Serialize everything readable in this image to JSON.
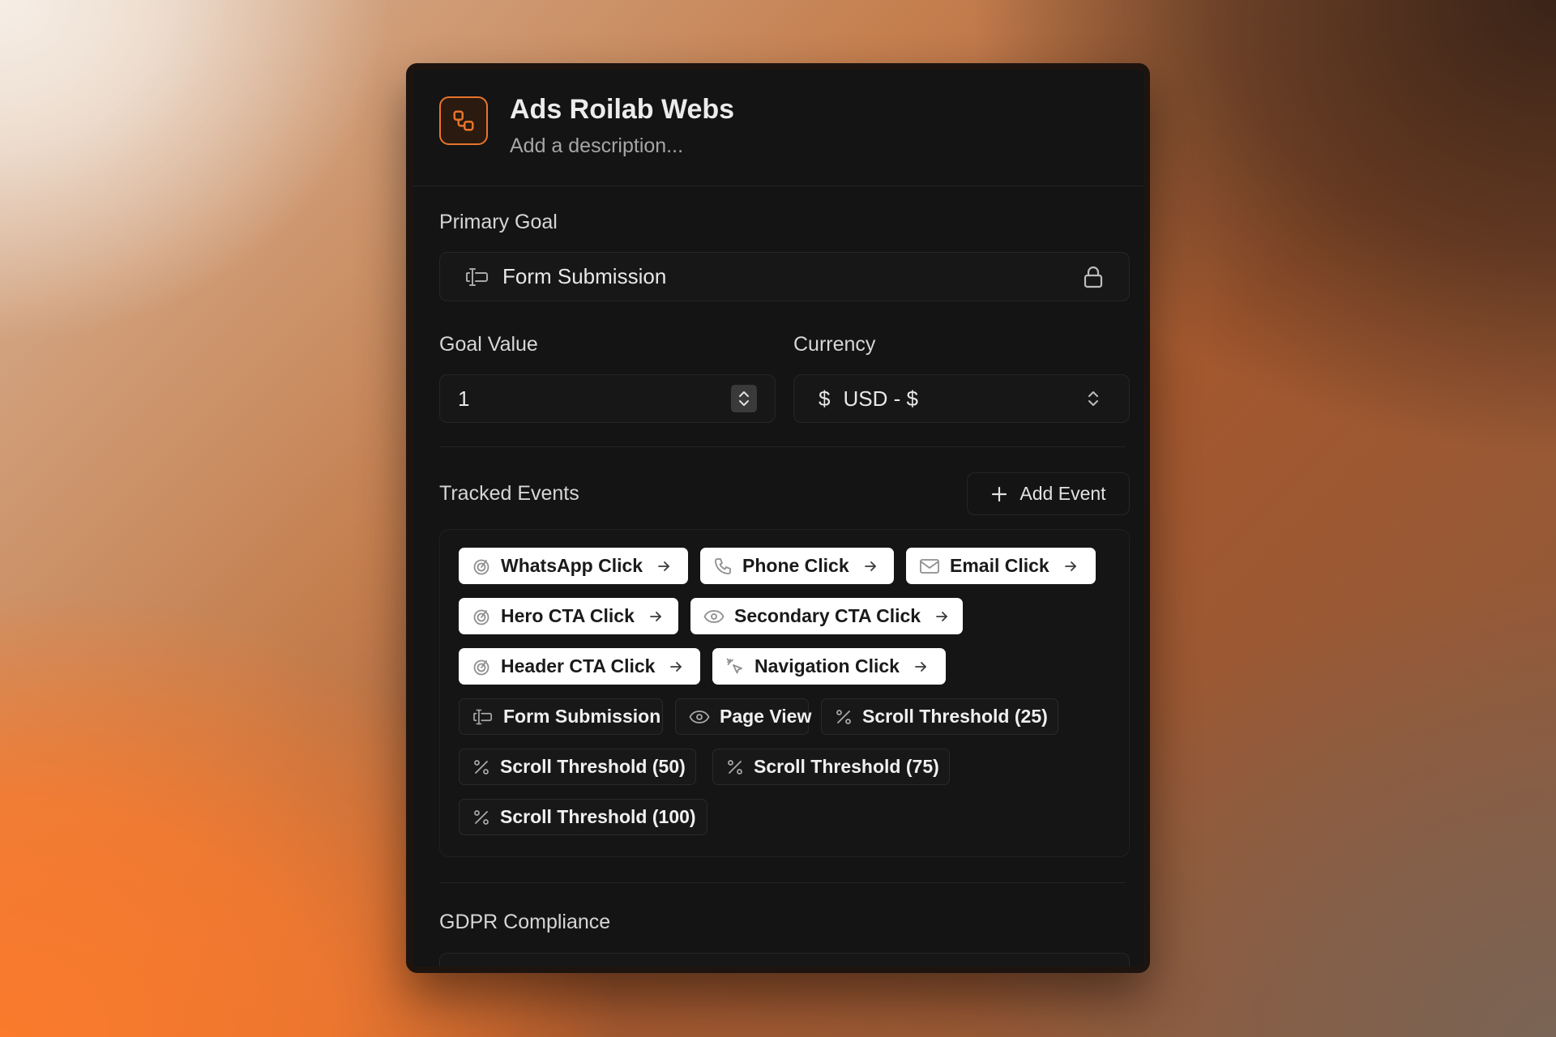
{
  "header": {
    "title": "Ads Roilab Webs",
    "description": "Add a description..."
  },
  "primary_goal": {
    "label": "Primary Goal",
    "value": "Form Submission",
    "icon": "form-icon",
    "locked_icon": "lock-icon"
  },
  "goal_value": {
    "label": "Goal Value",
    "value": "1"
  },
  "currency": {
    "label": "Currency",
    "symbol": "$",
    "value": "USD - $"
  },
  "tracked_events": {
    "label": "Tracked Events",
    "add_button": "Add Event",
    "events": [
      {
        "label": "WhatsApp Click",
        "icon": "pointer-click-icon",
        "style": "active"
      },
      {
        "label": "Phone Click",
        "icon": "phone-icon",
        "style": "active"
      },
      {
        "label": "Email Click",
        "icon": "mail-icon",
        "style": "active"
      },
      {
        "label": "Hero CTA Click",
        "icon": "pointer-click-icon",
        "style": "active"
      },
      {
        "label": "Secondary CTA Click",
        "icon": "eye-icon",
        "style": "active"
      },
      {
        "label": "Header CTA Click",
        "icon": "pointer-click-icon",
        "style": "active"
      },
      {
        "label": "Navigation Click",
        "icon": "cursor-click-icon",
        "style": "active"
      },
      {
        "label": "Form Submission",
        "icon": "form-icon",
        "style": "inactive"
      },
      {
        "label": "Page View",
        "icon": "eye-icon",
        "style": "inactive"
      },
      {
        "label": "Scroll Threshold (25)",
        "icon": "percent-icon",
        "style": "inactive"
      },
      {
        "label": "Scroll Threshold (50)",
        "icon": "percent-icon",
        "style": "inactive"
      },
      {
        "label": "Scroll Threshold (75)",
        "icon": "percent-icon",
        "style": "inactive"
      },
      {
        "label": "Scroll Threshold (100)",
        "icon": "percent-icon",
        "style": "inactive"
      }
    ]
  },
  "gdpr": {
    "label": "GDPR Compliance"
  },
  "colors": {
    "accent": "#e8742c",
    "card_bg": "#141414",
    "chip_active_bg": "#ffffff"
  }
}
